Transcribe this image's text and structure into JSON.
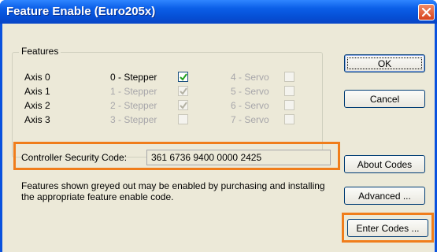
{
  "window": {
    "title": "Feature Enable (Euro205x)"
  },
  "features": {
    "group_label": "Features",
    "axes": [
      {
        "label": "Axis 0",
        "stepper": {
          "label": "0 - Stepper",
          "checked": true,
          "enabled": true
        },
        "servo": {
          "label": "4 - Servo",
          "checked": false,
          "enabled": false
        }
      },
      {
        "label": "Axis 1",
        "stepper": {
          "label": "1 - Stepper",
          "checked": true,
          "enabled": false
        },
        "servo": {
          "label": "5 - Servo",
          "checked": false,
          "enabled": false
        }
      },
      {
        "label": "Axis 2",
        "stepper": {
          "label": "2 - Stepper",
          "checked": true,
          "enabled": false
        },
        "servo": {
          "label": "6 - Servo",
          "checked": false,
          "enabled": false
        }
      },
      {
        "label": "Axis 3",
        "stepper": {
          "label": "3 - Stepper",
          "checked": false,
          "enabled": false
        },
        "servo": {
          "label": "7 - Servo",
          "checked": false,
          "enabled": false
        }
      }
    ]
  },
  "security": {
    "label": "Controller Security Code:",
    "value": "361 6736 9400 0000 2425"
  },
  "info_text": "Features shown greyed out may be enabled by purchasing and installing the appropriate feature enable code.",
  "buttons": {
    "ok": "OK",
    "cancel": "Cancel",
    "about": "About Codes",
    "advanced": "Advanced ...",
    "enter": "Enter Codes ..."
  },
  "colors": {
    "titlebar": "#0650d6",
    "dialog_bg": "#ece9d8",
    "highlight_frame": "#f07d1b",
    "disabled_text": "#a7a6aa"
  },
  "icons": {
    "close": "close-icon",
    "check": "check-icon"
  }
}
